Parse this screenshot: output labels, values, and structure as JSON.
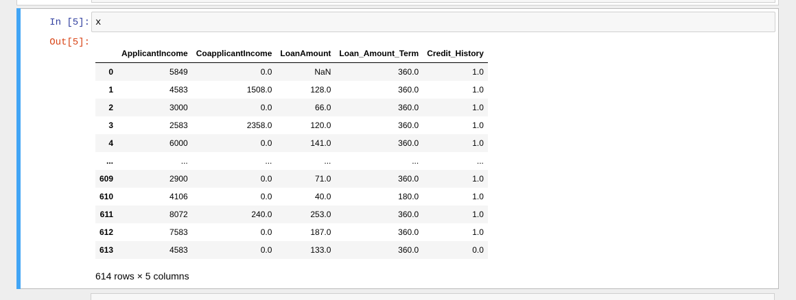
{
  "cell": {
    "in_prompt": "In [5]:",
    "code": "x",
    "out_prompt": "Out[5]:"
  },
  "dataframe": {
    "columns": [
      "",
      "ApplicantIncome",
      "CoapplicantIncome",
      "LoanAmount",
      "Loan_Amount_Term",
      "Credit_History"
    ],
    "rows": [
      [
        "0",
        "5849",
        "0.0",
        "NaN",
        "360.0",
        "1.0"
      ],
      [
        "1",
        "4583",
        "1508.0",
        "128.0",
        "360.0",
        "1.0"
      ],
      [
        "2",
        "3000",
        "0.0",
        "66.0",
        "360.0",
        "1.0"
      ],
      [
        "3",
        "2583",
        "2358.0",
        "120.0",
        "360.0",
        "1.0"
      ],
      [
        "4",
        "6000",
        "0.0",
        "141.0",
        "360.0",
        "1.0"
      ],
      [
        "...",
        "...",
        "...",
        "...",
        "...",
        "..."
      ],
      [
        "609",
        "2900",
        "0.0",
        "71.0",
        "360.0",
        "1.0"
      ],
      [
        "610",
        "4106",
        "0.0",
        "40.0",
        "180.0",
        "1.0"
      ],
      [
        "611",
        "8072",
        "240.0",
        "253.0",
        "360.0",
        "1.0"
      ],
      [
        "612",
        "7583",
        "0.0",
        "187.0",
        "360.0",
        "1.0"
      ],
      [
        "613",
        "4583",
        "0.0",
        "133.0",
        "360.0",
        "0.0"
      ]
    ],
    "shape": "614 rows × 5 columns"
  },
  "colors": {
    "selection_bar": "#42a5f5",
    "in_prompt": "#303f9f",
    "out_prompt": "#d84315"
  }
}
